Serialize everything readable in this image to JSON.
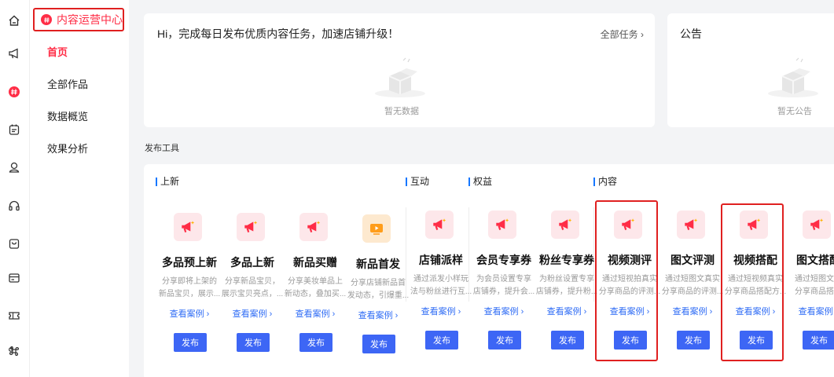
{
  "sidebar": {
    "header": "内容运营中心",
    "items": [
      "首页",
      "全部作品",
      "数据概览",
      "效果分析"
    ]
  },
  "tasks": {
    "title": "Hi，完成每日发布优质内容任务，加速店铺升级！",
    "all_link": "全部任务 ›",
    "empty": "暂无数据"
  },
  "notice": {
    "title": "公告",
    "empty": "暂无公告"
  },
  "tools": {
    "section_label": "发布工具",
    "groups": [
      "上新",
      "互动",
      "权益",
      "内容"
    ],
    "case_label": "查看案例 ›",
    "publish_label": "发布",
    "items": [
      {
        "name": "多品预上新",
        "desc1": "分享即将上架的",
        "desc2": "新品宝贝，展示..."
      },
      {
        "name": "多品上新",
        "desc1": "分享新品宝贝，",
        "desc2": "展示宝贝亮点，..."
      },
      {
        "name": "新品买赠",
        "desc1": "分享美妆单品上",
        "desc2": "新动态，叠加买..."
      },
      {
        "name": "新品首发",
        "desc1": "分享店铺新品首",
        "desc2": "发动态，引爆重..."
      },
      {
        "name": "店铺派样",
        "desc1": "通过派发小样玩",
        "desc2": "法与粉丝进行互..."
      },
      {
        "name": "会员专享券",
        "desc1": "为会员设置专享",
        "desc2": "店铺券，提升会..."
      },
      {
        "name": "粉丝专享券",
        "desc1": "为粉丝设置专享",
        "desc2": "店铺券，提升粉..."
      },
      {
        "name": "视频测评",
        "desc1": "通过短视拍真实",
        "desc2": "分享商品的评测..."
      },
      {
        "name": "图文评测",
        "desc1": "通过短图文真实",
        "desc2": "分享商品的评测..."
      },
      {
        "name": "视频搭配",
        "desc1": "通过短视频真实",
        "desc2": "分享商品搭配方..."
      },
      {
        "name": "图文搭配",
        "desc1": "通过短图文真",
        "desc2": "分享商品搭配"
      }
    ]
  },
  "colors": {
    "brand": "#ff2d46",
    "primary": "#3d66f5",
    "highlight": "#e02020"
  }
}
